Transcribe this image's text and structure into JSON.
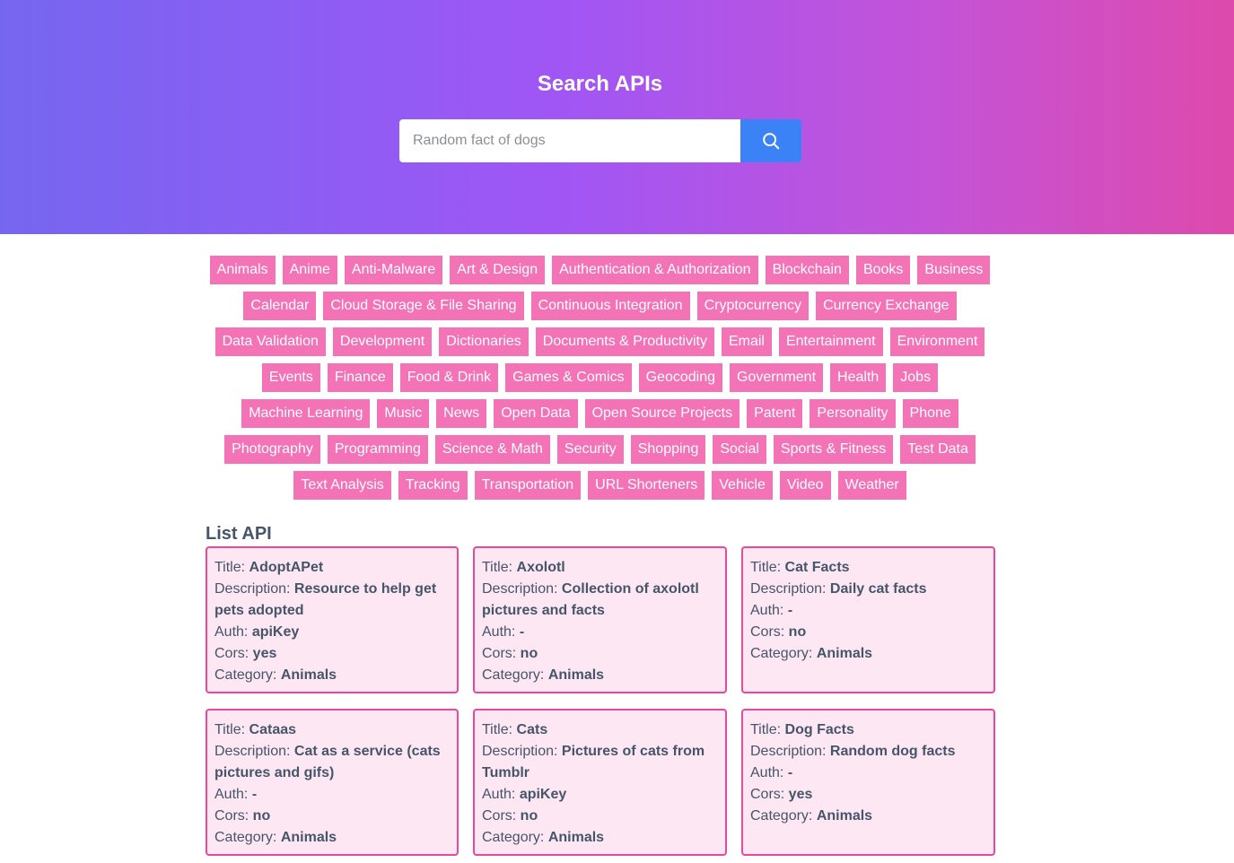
{
  "header": {
    "title": "Search APIs",
    "search_placeholder": "Random fact of dogs"
  },
  "colors": {
    "gradient_start": "#7566f0",
    "gradient_end": "#de4aac",
    "search_button": "#3b82f6",
    "tag_bg": "#f472b6",
    "card_bg": "#fce7f3",
    "card_border": "#ec4899"
  },
  "icons": {
    "search_button_icon": "search-icon"
  },
  "categories": [
    "Animals",
    "Anime",
    "Anti-Malware",
    "Art & Design",
    "Authentication & Authorization",
    "Blockchain",
    "Books",
    "Business",
    "Calendar",
    "Cloud Storage & File Sharing",
    "Continuous Integration",
    "Cryptocurrency",
    "Currency Exchange",
    "Data Validation",
    "Development",
    "Dictionaries",
    "Documents & Productivity",
    "Email",
    "Entertainment",
    "Environment",
    "Events",
    "Finance",
    "Food & Drink",
    "Games & Comics",
    "Geocoding",
    "Government",
    "Health",
    "Jobs",
    "Machine Learning",
    "Music",
    "News",
    "Open Data",
    "Open Source Projects",
    "Patent",
    "Personality",
    "Phone",
    "Photography",
    "Programming",
    "Science & Math",
    "Security",
    "Shopping",
    "Social",
    "Sports & Fitness",
    "Test Data",
    "Text Analysis",
    "Tracking",
    "Transportation",
    "URL Shorteners",
    "Vehicle",
    "Video",
    "Weather"
  ],
  "list": {
    "title": "List API",
    "labels": {
      "title": "Title: ",
      "description": "Description: ",
      "auth": "Auth: ",
      "cors": "Cors: ",
      "category": "Category: "
    },
    "items": [
      {
        "title": "AdoptAPet",
        "description": "Resource to help get pets adopted",
        "auth": "apiKey",
        "cors": "yes",
        "category": "Animals"
      },
      {
        "title": "Axolotl",
        "description": "Collection of axolotl pictures and facts",
        "auth": "-",
        "cors": "no",
        "category": "Animals"
      },
      {
        "title": "Cat Facts",
        "description": "Daily cat facts",
        "auth": "-",
        "cors": "no",
        "category": "Animals"
      },
      {
        "title": "Cataas",
        "description": "Cat as a service (cats pictures and gifs)",
        "auth": "-",
        "cors": "no",
        "category": "Animals"
      },
      {
        "title": "Cats",
        "description": "Pictures of cats from Tumblr",
        "auth": "apiKey",
        "cors": "no",
        "category": "Animals"
      },
      {
        "title": "Dog Facts",
        "description": "Random dog facts",
        "auth": "-",
        "cors": "yes",
        "category": "Animals"
      }
    ]
  }
}
